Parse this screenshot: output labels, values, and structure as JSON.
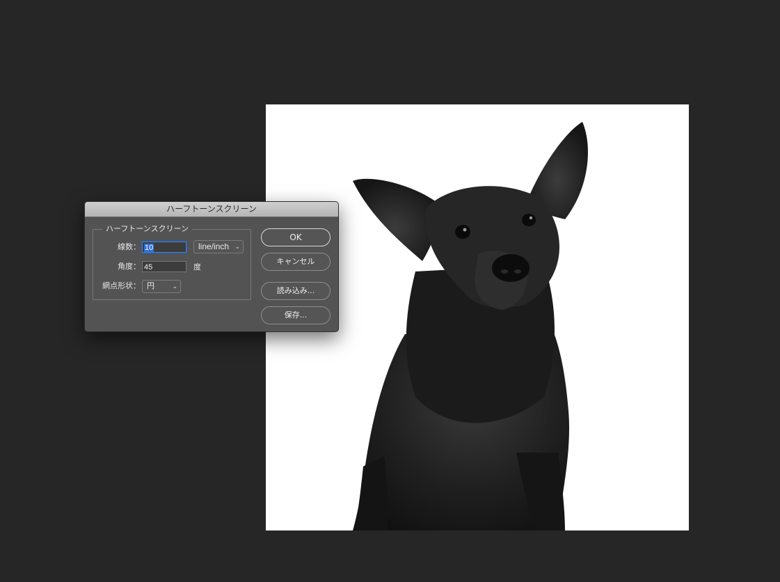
{
  "dialog": {
    "title": "ハーフトーンスクリーン",
    "group_title": "ハーフトーンスクリーン",
    "frequency": {
      "label": "線数：",
      "value": "10",
      "unit_selected": "line/inch"
    },
    "angle": {
      "label": "角度：",
      "value": "45",
      "unit": "度"
    },
    "shape": {
      "label": "網点形状：",
      "selected": "円"
    },
    "buttons": {
      "ok": "OK",
      "cancel": "キャンセル",
      "load": "読み込み...",
      "save": "保存..."
    }
  },
  "icons": {
    "dropdown": "chevron-down-icon"
  }
}
